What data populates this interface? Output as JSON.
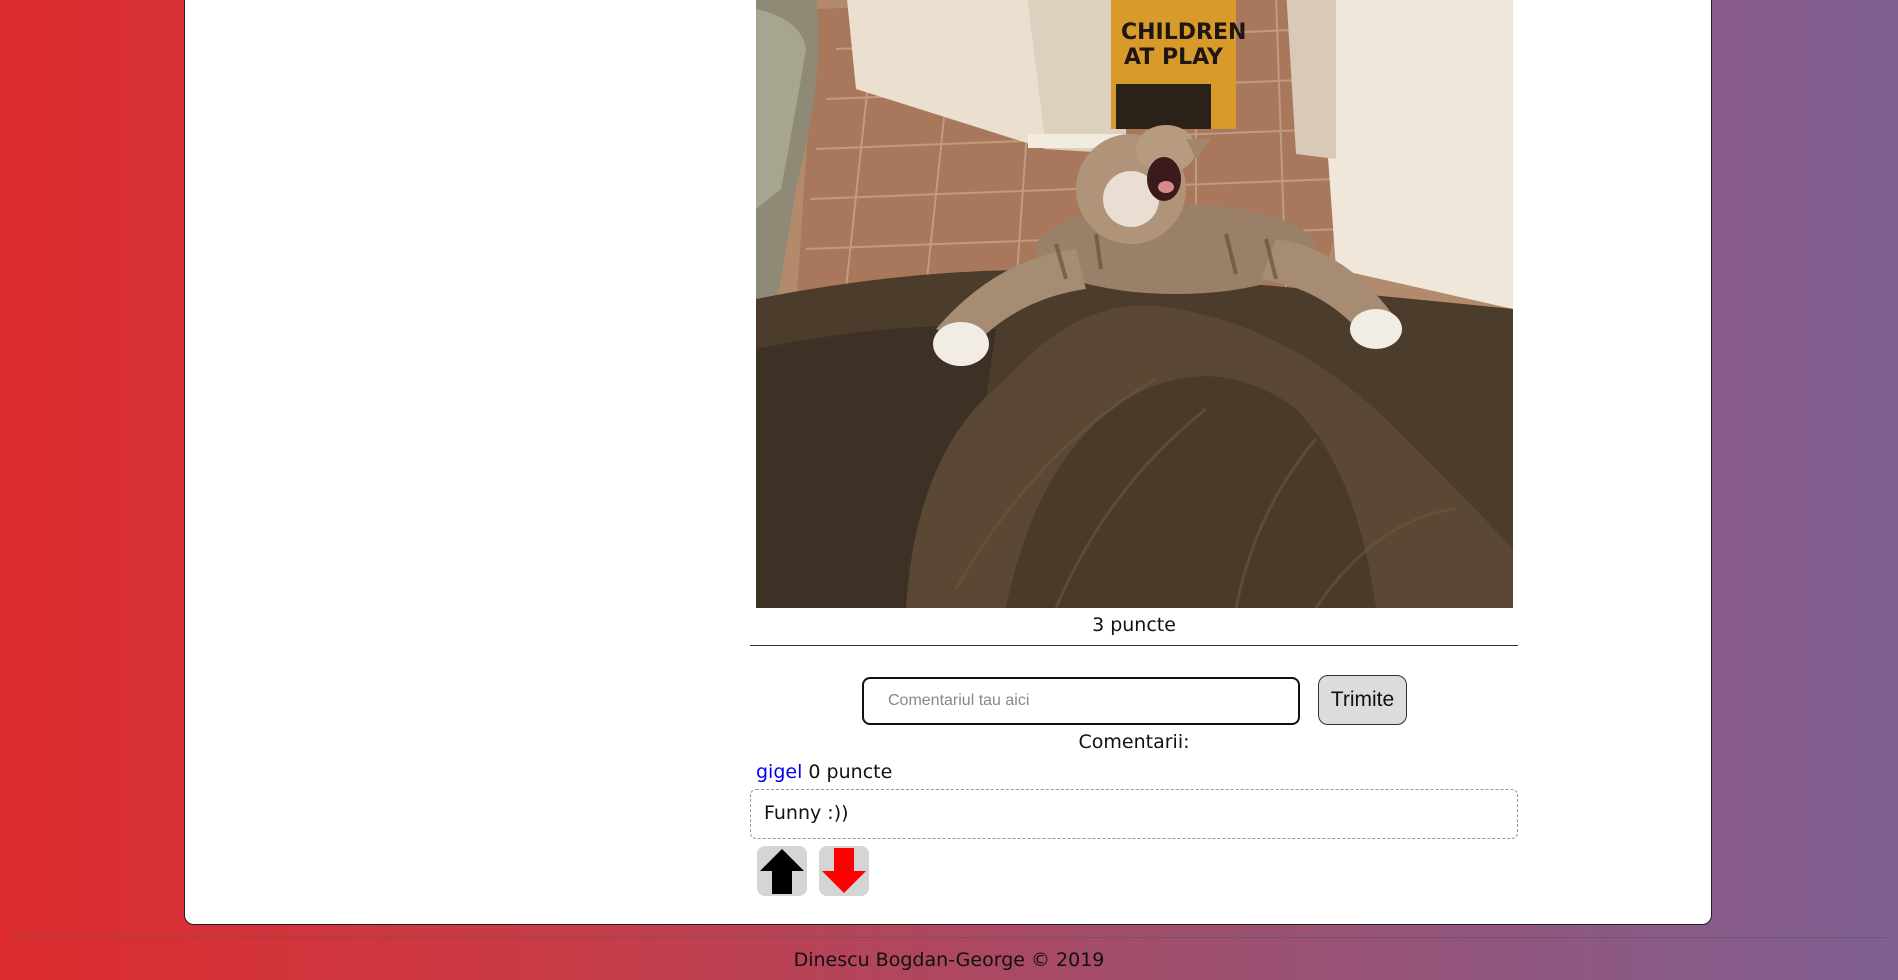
{
  "post": {
    "image_alt": "cat stretching on couch",
    "points": "3 puncte"
  },
  "comment_form": {
    "placeholder": "Comentariul tau aici",
    "submit_label": "Trimite"
  },
  "comments_section": {
    "title": "Comentarii:",
    "comments": [
      {
        "author": "gigel",
        "points": "0 puncte",
        "text": "Funny :))"
      }
    ],
    "upvote_icon": "arrow-up-icon",
    "downvote_icon": "arrow-down-icon",
    "colors": {
      "upvote": "#000000",
      "downvote": "#ff0000",
      "author_link": "#0000ee"
    }
  },
  "footer": {
    "text": "Dinescu Bogdan-George © 2019"
  }
}
